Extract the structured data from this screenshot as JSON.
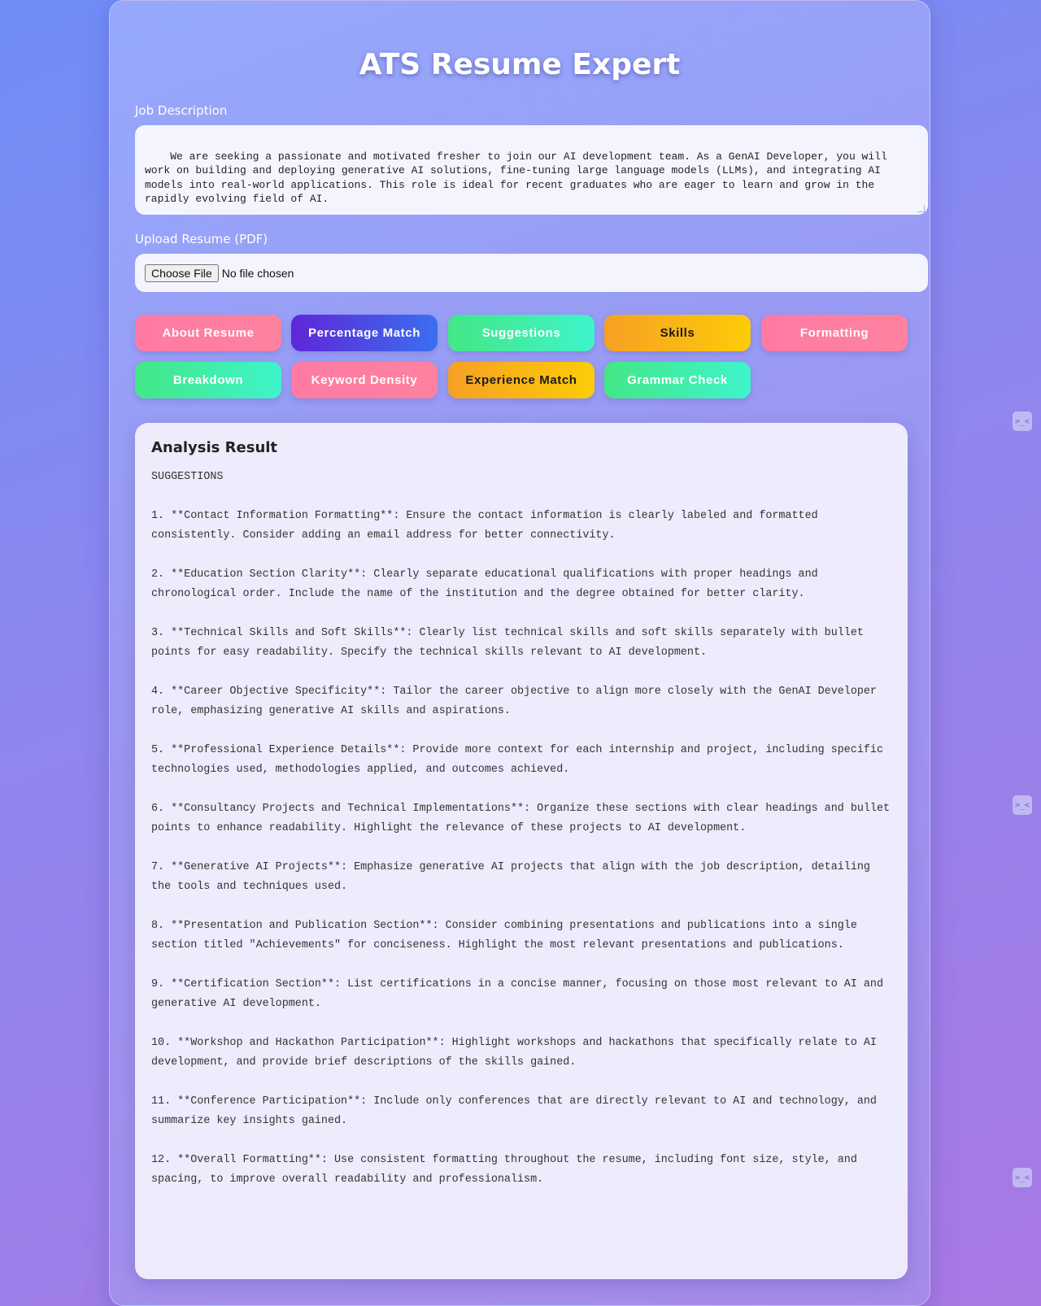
{
  "app": {
    "title": "ATS Resume Expert"
  },
  "job_description": {
    "label": "Job Description",
    "value": "We are seeking a passionate and motivated fresher to join our AI development team. As a GenAI Developer, you will work on building and deploying generative AI solutions, fine-tuning large language models (LLMs), and integrating AI models into real-world applications. This role is ideal for recent graduates who are eager to learn and grow in the rapidly evolving field of AI."
  },
  "upload": {
    "label": "Upload Resume (PDF)",
    "button_label": "Choose File",
    "status": "No file chosen"
  },
  "actions": [
    {
      "label": "About Resume",
      "color": "#ff7aa2"
    },
    {
      "label": "Percentage Match",
      "color": "#5f26d9"
    },
    {
      "label": "Suggestions",
      "color": "#43e786"
    },
    {
      "label": "Skills",
      "color": "#f7a024"
    },
    {
      "label": "Formatting",
      "color": "#ff7aa2"
    },
    {
      "label": "Breakdown",
      "color": "#43e786"
    },
    {
      "label": "Keyword Density",
      "color": "#ff7aa2"
    },
    {
      "label": "Experience Match",
      "color": "#f7a024"
    },
    {
      "label": "Grammar Check",
      "color": "#43e786"
    }
  ],
  "result": {
    "heading": "Analysis Result",
    "text": "SUGGESTIONS\n\n1. **Contact Information Formatting**: Ensure the contact information is clearly labeled and formatted consistently. Consider adding an email address for better connectivity.\n\n2. **Education Section Clarity**: Clearly separate educational qualifications with proper headings and chronological order. Include the name of the institution and the degree obtained for better clarity.\n\n3. **Technical Skills and Soft Skills**: Clearly list technical skills and soft skills separately with bullet points for easy readability. Specify the technical skills relevant to AI development.\n\n4. **Career Objective Specificity**: Tailor the career objective to align more closely with the GenAI Developer role, emphasizing generative AI skills and aspirations.\n\n5. **Professional Experience Details**: Provide more context for each internship and project, including specific technologies used, methodologies applied, and outcomes achieved.\n\n6. **Consultancy Projects and Technical Implementations**: Organize these sections with clear headings and bullet points to enhance readability. Highlight the relevance of these projects to AI development.\n\n7. **Generative AI Projects**: Emphasize generative AI projects that align with the job description, detailing the tools and techniques used.\n\n8. **Presentation and Publication Section**: Consider combining presentations and publications into a single section titled \"Achievements\" for conciseness. Highlight the most relevant presentations and publications.\n\n9. **Certification Section**: List certifications in a concise manner, focusing on those most relevant to AI and generative AI development.\n\n10. **Workshop and Hackathon Participation**: Highlight workshops and hackathons that specifically relate to AI development, and provide brief descriptions of the skills gained.\n\n11. **Conference Participation**: Include only conferences that are directly relevant to AI and technology, and summarize key insights gained.\n\n12. **Overall Formatting**: Use consistent formatting throughout the resume, including font size, style, and spacing, to improve overall readability and professionalism."
  },
  "side_widget": {
    "icon": "terminal-icon",
    "glyph": ">_<"
  }
}
